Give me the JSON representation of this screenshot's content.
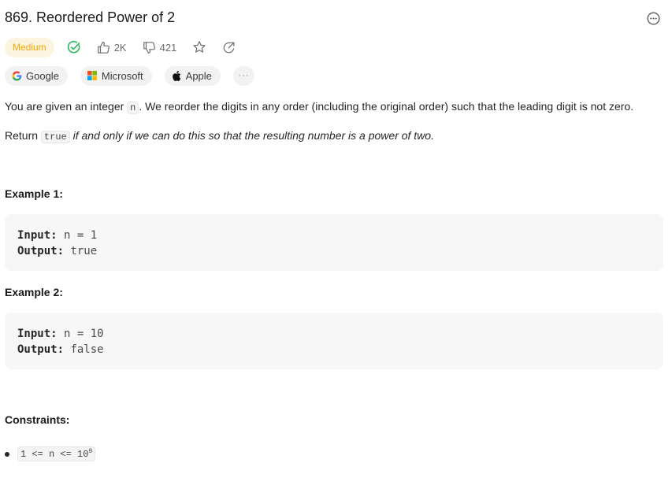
{
  "problem": {
    "title": "869. Reordered Power of 2",
    "difficulty": "Medium",
    "likes": "2K",
    "dislikes": "421"
  },
  "companies": [
    {
      "name": "Google"
    },
    {
      "name": "Microsoft"
    },
    {
      "name": "Apple"
    }
  ],
  "more_tags_label": "···",
  "description": {
    "p1_before": "You are given an integer ",
    "p1_code": "n",
    "p1_after": ". We reorder the digits in any order (including the original order) such that the leading digit is not zero.",
    "p2_before": "Return ",
    "p2_code": "true",
    "p2_after": " if and only if we can do this so that the resulting number is a power of two."
  },
  "examples": [
    {
      "heading": "Example 1:",
      "input_label": "Input:",
      "input": " n = 1",
      "output_label": "Output:",
      "output": " true"
    },
    {
      "heading": "Example 2:",
      "input_label": "Input:",
      "input": " n = 10",
      "output_label": "Output:",
      "output": " false"
    }
  ],
  "constraints": {
    "heading": "Constraints:",
    "item_base": "1 <= n <= 10",
    "item_exp": "9"
  },
  "colors": {
    "difficulty_medium": "#f0a800",
    "solved_check": "#2db55d"
  }
}
